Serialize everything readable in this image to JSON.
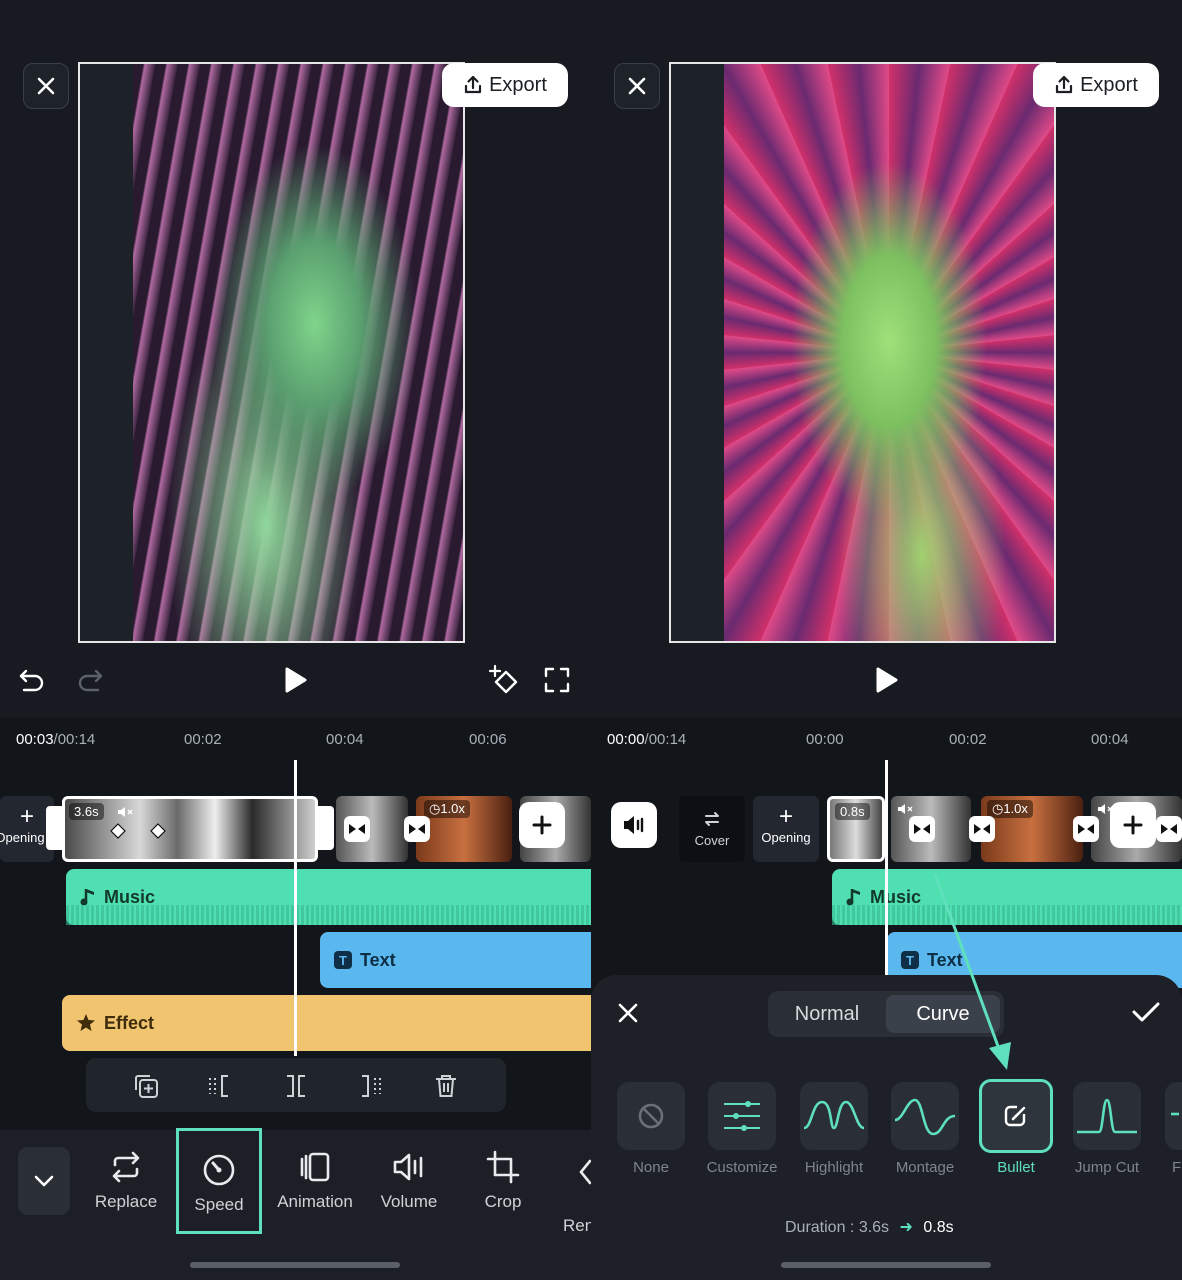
{
  "left": {
    "export_label": "Export",
    "time_current": "00:03",
    "time_total": "/00:14",
    "ticks": [
      "00:02",
      "00:04",
      "00:06"
    ],
    "opening_label": "Opening",
    "clip_duration": "3.6s",
    "speed_badge": "1.0x",
    "tracks": {
      "music": "Music",
      "text": "Text",
      "effect": "Effect"
    },
    "bottom_bar": [
      "Replace",
      "Speed",
      "Animation",
      "Volume",
      "Crop",
      "Ren"
    ]
  },
  "right": {
    "export_label": "Export",
    "time_current": "00:00",
    "time_total": "/00:14",
    "ticks": [
      "00:00",
      "00:02",
      "00:04"
    ],
    "cover_label": "Cover",
    "opening_label": "Opening",
    "clip_duration": "0.8s",
    "speed_badge": "1.0x",
    "tracks": {
      "music": "Music",
      "text": "Text"
    },
    "speed_sheet": {
      "tab_normal": "Normal",
      "tab_curve": "Curve",
      "presets": [
        "None",
        "Customize",
        "Highlight",
        "Montage",
        "Bullet",
        "Jump Cut",
        "F"
      ],
      "selected_preset": "Bullet",
      "duration_label": "Duration : 3.6s",
      "duration_new": "0.8s"
    }
  },
  "colors": {
    "accent": "#5ee0bd",
    "music_track": "#4fdfb0",
    "text_track": "#5bb8ee",
    "effect_track": "#f1c470",
    "background": "#171b21"
  }
}
